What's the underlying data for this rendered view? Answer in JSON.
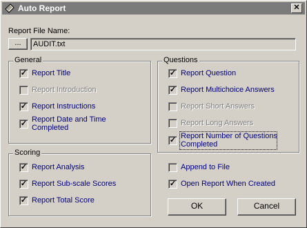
{
  "window": {
    "title": "Auto Report",
    "close_glyph": "✕"
  },
  "report_file": {
    "label": "Report File Name:",
    "browse_label": "...",
    "value": "AUDIT.txt"
  },
  "general": {
    "title": "General",
    "items": [
      {
        "label": "Report Title",
        "checked": true,
        "enabled": true
      },
      {
        "label": "Report Introduction",
        "checked": false,
        "enabled": false
      },
      {
        "label": "Report Instructions",
        "checked": true,
        "enabled": true
      },
      {
        "label": "Report Date and Time Completed",
        "line1": "Report Date and Time",
        "line2": "Completed",
        "checked": true,
        "enabled": true
      }
    ]
  },
  "questions": {
    "title": "Questions",
    "items": [
      {
        "label": "Report Question",
        "checked": true,
        "enabled": true
      },
      {
        "label": "Report Multichoice Answers",
        "checked": true,
        "enabled": true
      },
      {
        "label": "Report Short Answers",
        "checked": false,
        "enabled": false
      },
      {
        "label": "Report Long Answers",
        "checked": false,
        "enabled": false
      },
      {
        "label": "Report Number of Questions Completed",
        "line1": "Report Number of Questions",
        "line2": "Completed",
        "checked": true,
        "enabled": true
      }
    ]
  },
  "scoring": {
    "title": "Scoring",
    "items": [
      {
        "label": "Report Analysis",
        "checked": true,
        "enabled": true
      },
      {
        "label": "Report Sub-scale Scores",
        "checked": true,
        "enabled": true
      },
      {
        "label": "Report Total Score",
        "checked": true,
        "enabled": true
      }
    ]
  },
  "options": {
    "append": {
      "label": "Append to File",
      "checked": false
    },
    "open_report": {
      "label": "Open Report When Created",
      "checked": true
    }
  },
  "buttons": {
    "ok": "OK",
    "cancel": "Cancel"
  },
  "icons": {
    "title_icon": "scroll-icon",
    "check_glyph": "✓"
  }
}
